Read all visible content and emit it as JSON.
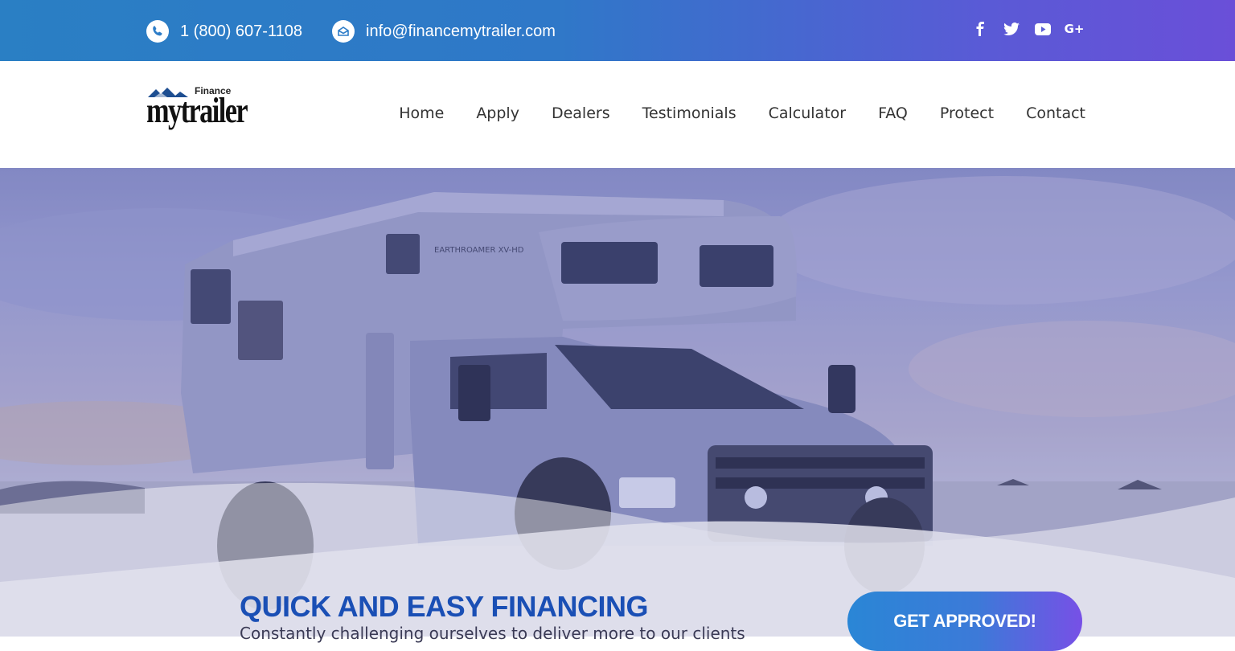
{
  "topbar": {
    "phone": "1 (800) 607-1108",
    "email": "info@financemytrailer.com",
    "socials": [
      "facebook-icon",
      "twitter-icon",
      "youtube-icon",
      "google-plus-icon"
    ],
    "gplus_text": "G+"
  },
  "logo": {
    "small": "Finance",
    "big": "mytrailer"
  },
  "nav": {
    "items": [
      "Home",
      "Apply",
      "Dealers",
      "Testimonials",
      "Calculator",
      "FAQ",
      "Protect",
      "Contact"
    ]
  },
  "hero": {
    "vehicle_text": "EARTHROAMER XV-HD"
  },
  "cta": {
    "title": "QUICK AND EASY FINANCING",
    "subtitle": "Constantly challenging ourselves to deliver more to our clients",
    "button": "GET APPROVED!"
  },
  "colors": {
    "topbar_start": "#2a7fc4",
    "topbar_end": "#6a4fd8",
    "cta_title": "#1a4fb5",
    "button_start": "#2a86d6",
    "button_end": "#7750e6"
  }
}
